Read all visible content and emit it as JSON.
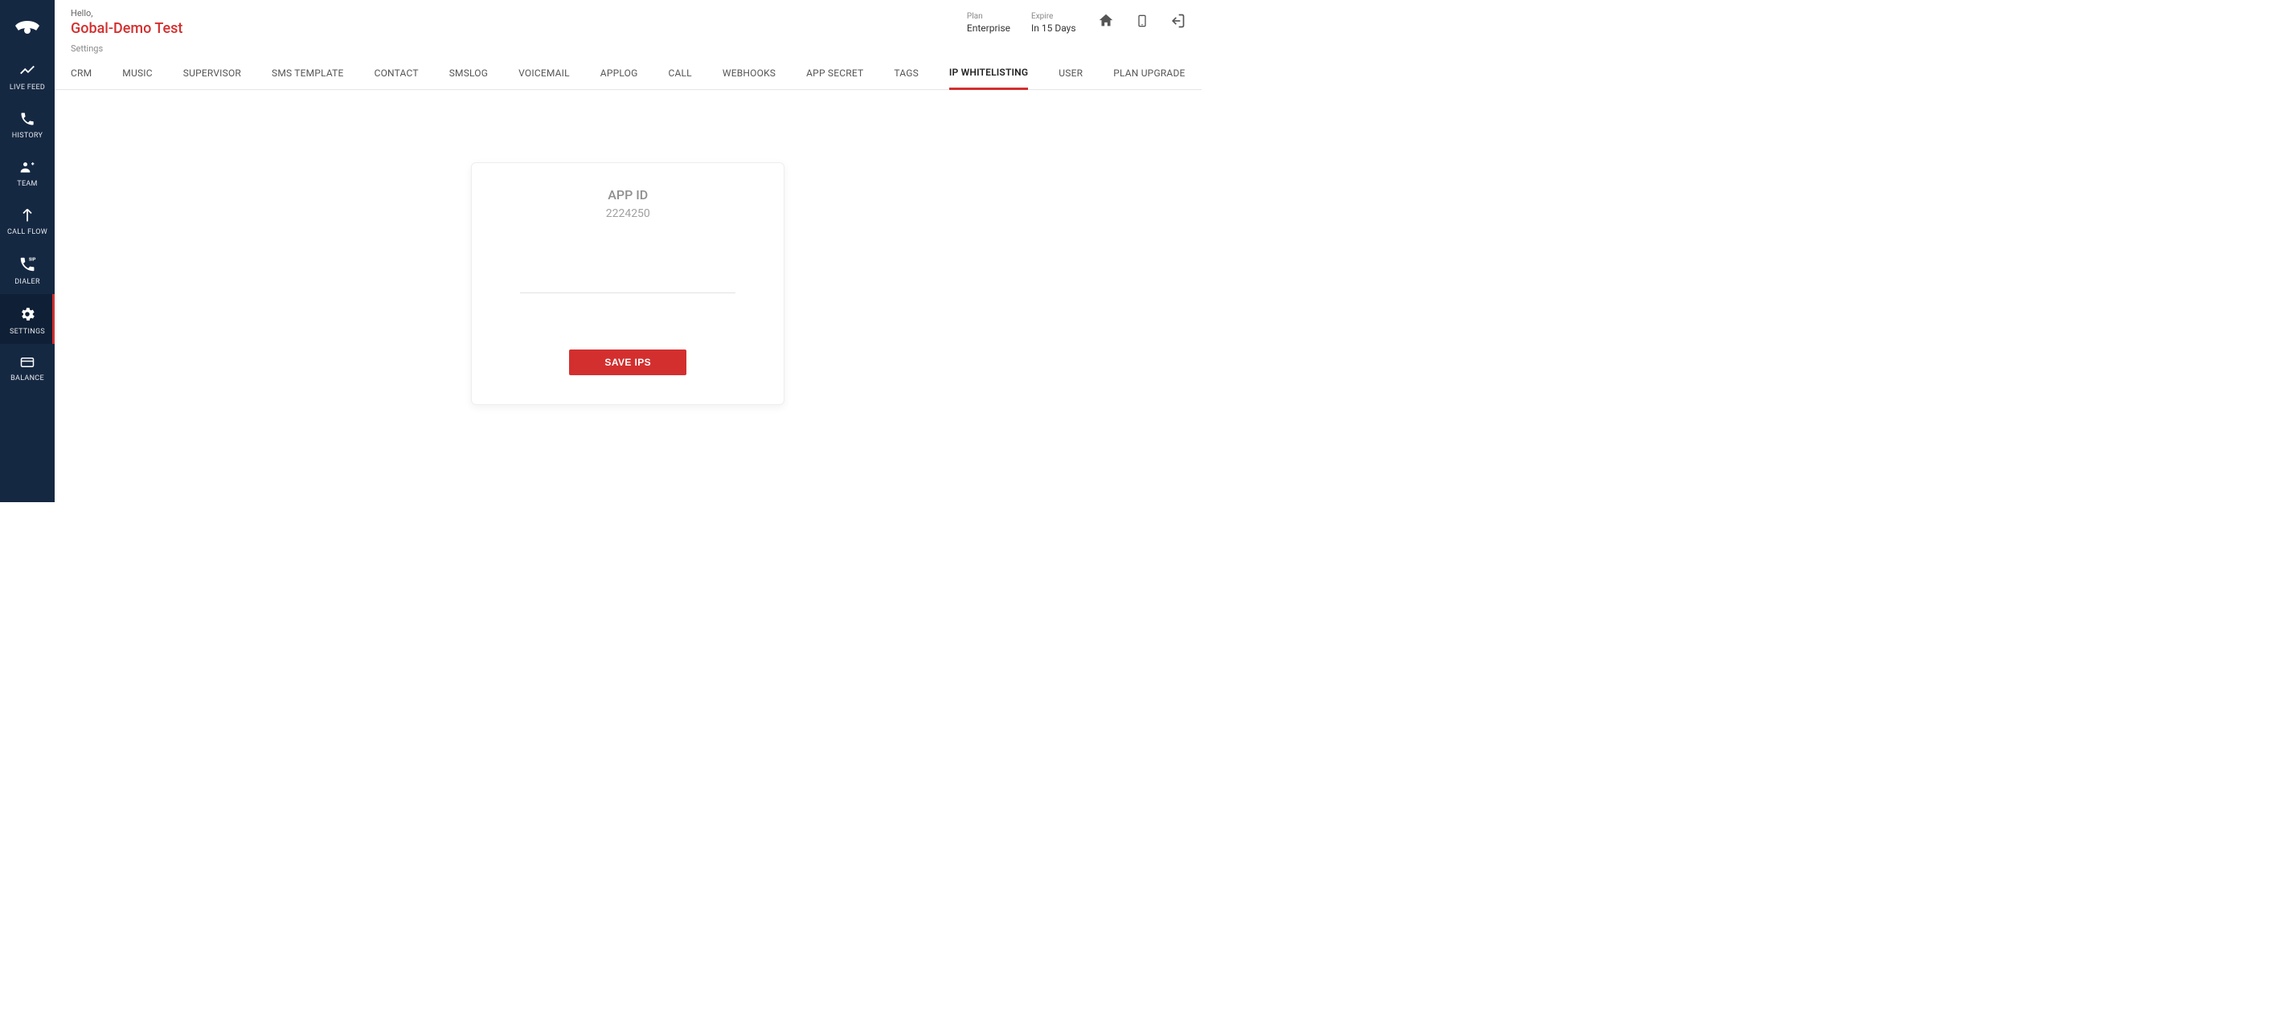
{
  "header": {
    "greeting": "Hello,",
    "tenant": "Gobal-Demo Test",
    "plan_label": "Plan",
    "plan_value": "Enterprise",
    "expire_label": "Expire",
    "expire_value": "In 15 Days"
  },
  "breadcrumb": "Settings",
  "sidebar": {
    "items": [
      {
        "label": "LIVE FEED"
      },
      {
        "label": "HISTORY"
      },
      {
        "label": "TEAM"
      },
      {
        "label": "CALL FLOW"
      },
      {
        "label": "DIALER"
      },
      {
        "label": "SETTINGS"
      },
      {
        "label": "BALANCE"
      }
    ]
  },
  "tabs": [
    {
      "label": "CRM"
    },
    {
      "label": "MUSIC"
    },
    {
      "label": "SUPERVISOR"
    },
    {
      "label": "SMS TEMPLATE"
    },
    {
      "label": "CONTACT"
    },
    {
      "label": "SMSLOG"
    },
    {
      "label": "VOICEMAIL"
    },
    {
      "label": "APPLOG"
    },
    {
      "label": "CALL"
    },
    {
      "label": "WEBHOOKS"
    },
    {
      "label": "APP SECRET"
    },
    {
      "label": "TAGS"
    },
    {
      "label": "IP WHITELISTING"
    },
    {
      "label": "USER"
    },
    {
      "label": "PLAN UPGRADE"
    }
  ],
  "active_tab_index": 12,
  "card": {
    "title": "APP ID",
    "value": "2224250",
    "button": "SAVE IPS"
  }
}
